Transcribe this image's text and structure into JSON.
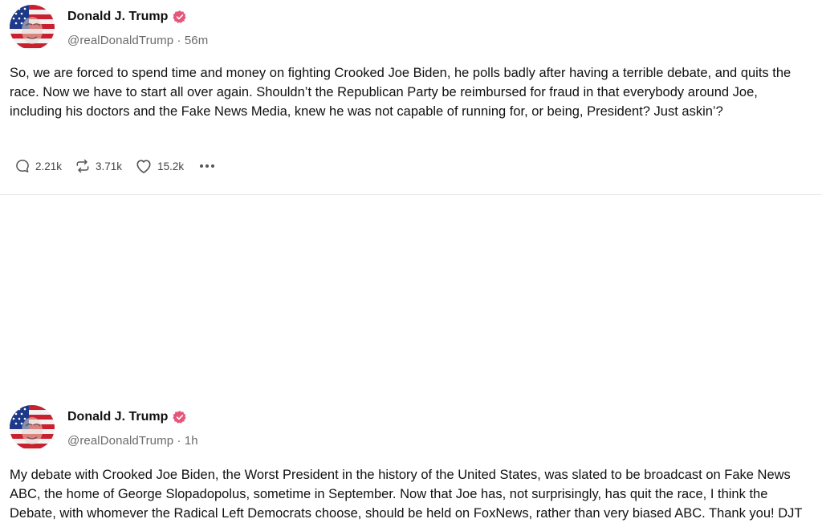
{
  "posts": [
    {
      "author": {
        "display_name": "Donald J. Trump",
        "handle": "@realDonaldTrump",
        "separator": "·",
        "time": "56m",
        "avatar_icon": "flag-portrait-avatar",
        "verified_icon": "verified-badge-icon",
        "verified_color": "#e4567a"
      },
      "text": "So, we are forced to spend time and money on fighting Crooked Joe Biden, he polls badly after having a terrible debate, and quits the race. Now we have to start all over again. Shouldn’t the Republican Party be reimbursed for fraud in that everybody around Joe, including his doctors and the Fake News Media, knew he was not capable of running for, or being, President? Just askin’?",
      "actions": {
        "replies": "2.21k",
        "reposts": "3.71k",
        "likes": "15.2k"
      }
    },
    {
      "author": {
        "display_name": "Donald J. Trump",
        "handle": "@realDonaldTrump",
        "separator": "·",
        "time": "1h",
        "avatar_icon": "flag-portrait-avatar",
        "verified_icon": "verified-badge-icon",
        "verified_color": "#e4567a"
      },
      "text": "My debate with Crooked Joe Biden, the Worst President in the history of the United States, was slated to be broadcast on Fake News ABC, the home of George Slopadopolus, sometime in September. Now that Joe has, not surprisingly, has quit the race, I think the Debate, with whomever the Radical Left Democrats choose, should be held on FoxNews, rather than very biased ABC. Thank you! DJT"
    }
  ]
}
